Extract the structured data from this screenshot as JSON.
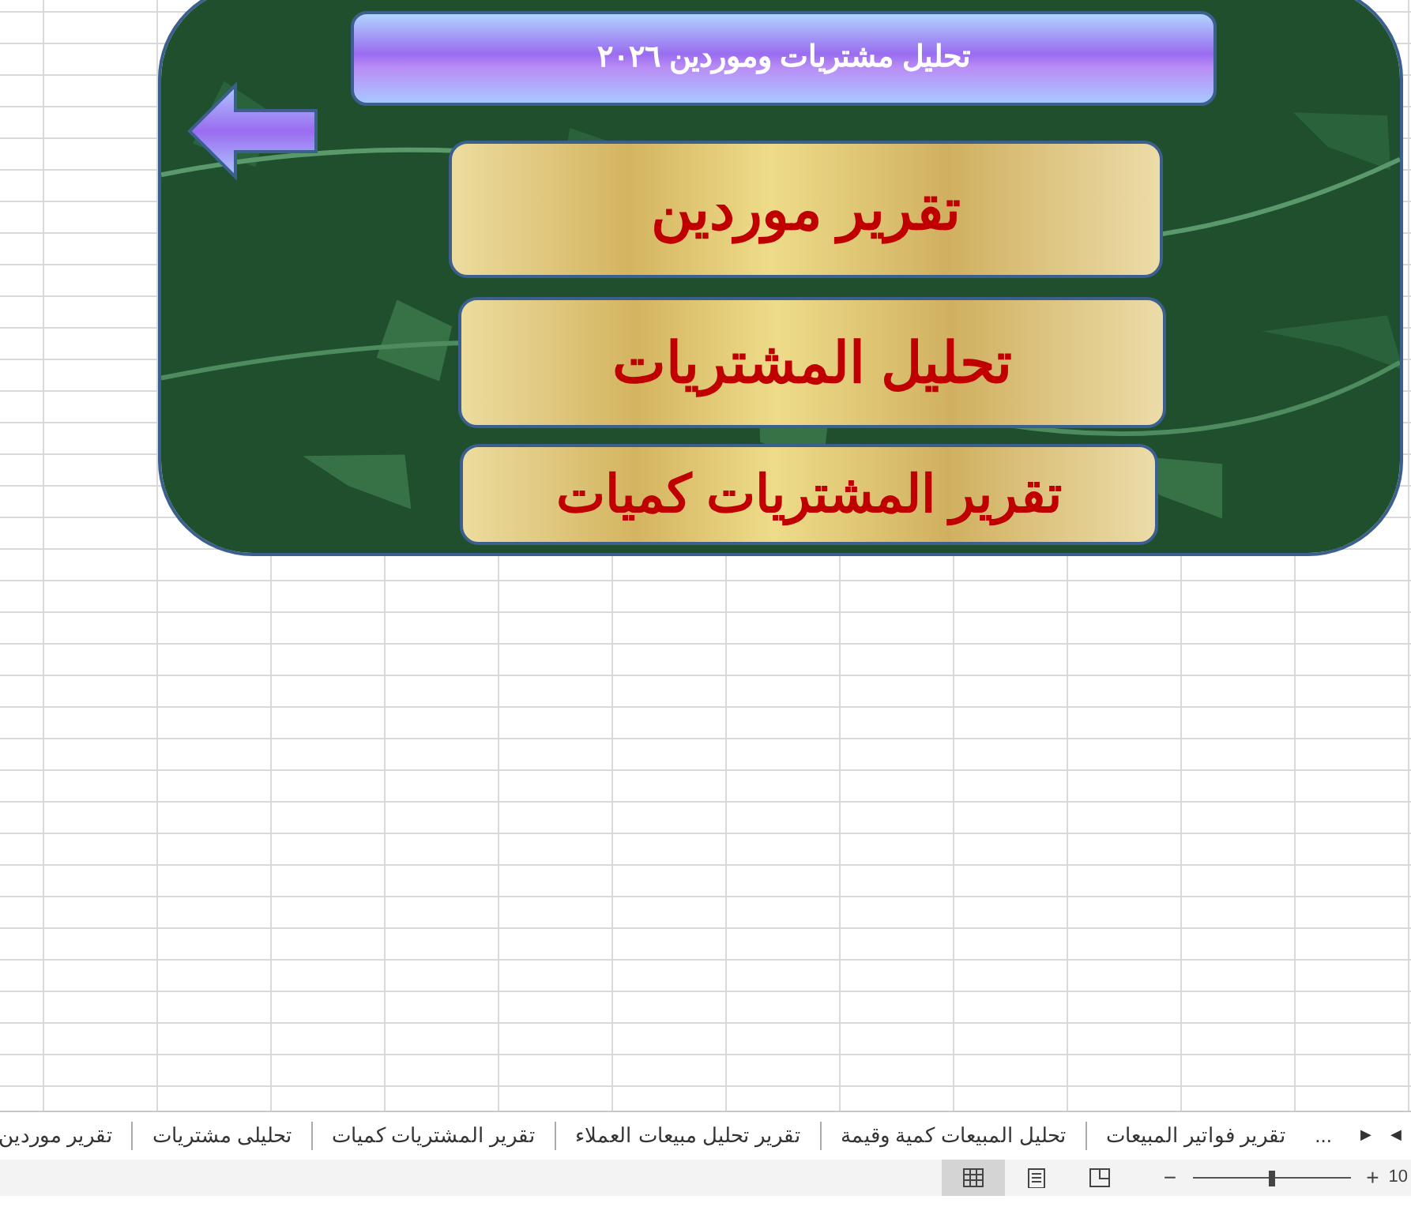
{
  "panel": {
    "title": "تحليل مشتريات وموردين ٢٠٢٦",
    "buttons": [
      {
        "label": "تقرير موردين"
      },
      {
        "label": "تحليل المشتريات"
      },
      {
        "label": "تقرير المشتريات كميات"
      }
    ]
  },
  "sheet_tabs": {
    "nav": [
      "◀",
      "▶"
    ],
    "more": "...",
    "tabs": [
      {
        "label": "تقرير فواتير المبيعات",
        "selected": false
      },
      {
        "label": "تحليل المبيعات كمية وقيمة",
        "selected": false
      },
      {
        "label": "تقرير تحليل مبيعات العملاء",
        "selected": false
      },
      {
        "label": "تقرير المشتريات كميات",
        "selected": false
      },
      {
        "label": "تحليلى مشتريات",
        "selected": false
      },
      {
        "label": "تقرير موردين",
        "selected": false
      }
    ]
  },
  "status_bar": {
    "views": [
      {
        "kind": "normal",
        "selected": true
      },
      {
        "kind": "layout",
        "selected": false
      },
      {
        "kind": "pagebreak",
        "selected": false
      }
    ],
    "zoom": {
      "minus": "−",
      "plus": "+",
      "level": 0.5,
      "reading": "10"
    }
  }
}
